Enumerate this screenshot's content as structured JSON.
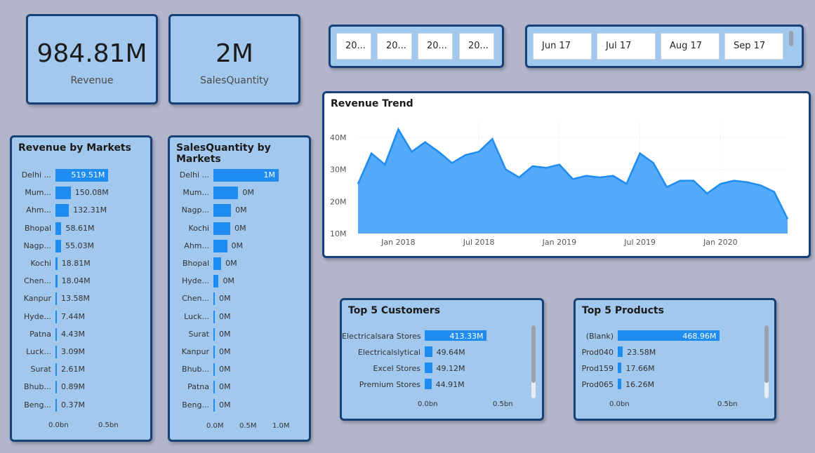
{
  "kpis": {
    "revenue_value": "984.81M",
    "revenue_label": "Revenue",
    "qty_value": "2M",
    "qty_label": "SalesQuantity"
  },
  "year_slicer": {
    "items": [
      "20...",
      "20...",
      "20...",
      "20..."
    ]
  },
  "month_slicer": {
    "items": [
      "Jun 17",
      "Jul 17",
      "Aug 17",
      "Sep 17"
    ]
  },
  "rev_by_market": {
    "title": "Revenue by Markets",
    "rows": [
      {
        "label": "Delhi ...",
        "value": 519.51,
        "text": "519.51M"
      },
      {
        "label": "Mum...",
        "value": 150.08,
        "text": "150.08M"
      },
      {
        "label": "Ahm...",
        "value": 132.31,
        "text": "132.31M"
      },
      {
        "label": "Bhopal",
        "value": 58.61,
        "text": "58.61M"
      },
      {
        "label": "Nagp...",
        "value": 55.03,
        "text": "55.03M"
      },
      {
        "label": "Kochi",
        "value": 18.81,
        "text": "18.81M"
      },
      {
        "label": "Chen...",
        "value": 18.04,
        "text": "18.04M"
      },
      {
        "label": "Kanpur",
        "value": 13.58,
        "text": "13.58M"
      },
      {
        "label": "Hyde...",
        "value": 7.44,
        "text": "7.44M"
      },
      {
        "label": "Patna",
        "value": 4.43,
        "text": "4.43M"
      },
      {
        "label": "Luck...",
        "value": 3.09,
        "text": "3.09M"
      },
      {
        "label": "Surat",
        "value": 2.61,
        "text": "2.61M"
      },
      {
        "label": "Bhub...",
        "value": 0.89,
        "text": "0.89M"
      },
      {
        "label": "Beng...",
        "value": 0.37,
        "text": "0.37M"
      }
    ],
    "axis": [
      "0.0bn",
      "0.5bn"
    ]
  },
  "qty_by_market": {
    "title": "SalesQuantity by Markets",
    "rows": [
      {
        "label": "Delhi ...",
        "value": 1.0,
        "text": "1M"
      },
      {
        "label": "Mum...",
        "value": 0.38,
        "text": "0M"
      },
      {
        "label": "Nagp...",
        "value": 0.27,
        "text": "0M"
      },
      {
        "label": "Kochi",
        "value": 0.26,
        "text": "0M"
      },
      {
        "label": "Ahm...",
        "value": 0.21,
        "text": "0M"
      },
      {
        "label": "Bhopal",
        "value": 0.12,
        "text": "0M"
      },
      {
        "label": "Hyde...",
        "value": 0.08,
        "text": "0M"
      },
      {
        "label": "Chen...",
        "value": 0.02,
        "text": "0M"
      },
      {
        "label": "Luck...",
        "value": 0.02,
        "text": "0M"
      },
      {
        "label": "Surat",
        "value": 0.01,
        "text": "0M"
      },
      {
        "label": "Kanpur",
        "value": 0.01,
        "text": "0M"
      },
      {
        "label": "Bhub...",
        "value": 0.01,
        "text": "0M"
      },
      {
        "label": "Patna",
        "value": 0.01,
        "text": "0M"
      },
      {
        "label": "Beng...",
        "value": 0.01,
        "text": "0M"
      }
    ],
    "axis": [
      "0.0M",
      "0.5M",
      "1.0M"
    ]
  },
  "chart_data": {
    "type": "area",
    "title": "Revenue Trend",
    "x": [
      "2017-10",
      "2017-11",
      "2017-12",
      "2018-01",
      "2018-02",
      "2018-03",
      "2018-04",
      "2018-05",
      "2018-06",
      "2018-07",
      "2018-08",
      "2018-09",
      "2018-10",
      "2018-11",
      "2018-12",
      "2019-01",
      "2019-02",
      "2019-03",
      "2019-04",
      "2019-05",
      "2019-06",
      "2019-07",
      "2019-08",
      "2019-09",
      "2019-10",
      "2019-11",
      "2019-12",
      "2020-01",
      "2020-02",
      "2020-03",
      "2020-04",
      "2020-05",
      "2020-06"
    ],
    "values": [
      25.5,
      35,
      31.5,
      42.5,
      35.5,
      38.5,
      35.5,
      32,
      34.5,
      35.5,
      39.5,
      30,
      27.5,
      31,
      30.5,
      31.5,
      27,
      28,
      27.5,
      28,
      25.5,
      35,
      32,
      24.5,
      26.5,
      26.5,
      22.5,
      25.5,
      26.5,
      26,
      25,
      23,
      14.5
    ],
    "x_ticks": [
      "Jan 2018",
      "Jul 2018",
      "Jan 2019",
      "Jul 2019",
      "Jan 2020"
    ],
    "y_ticks": [
      "10M",
      "20M",
      "30M",
      "40M"
    ],
    "ylim": [
      10,
      45
    ],
    "color": "#55a9fb",
    "line_color": "#1e8cf0"
  },
  "top_customers": {
    "title": "Top 5 Customers",
    "rows": [
      {
        "label": "Electricalsara Stores",
        "value": 413.33,
        "text": "413.33M"
      },
      {
        "label": "Electricalslytical",
        "value": 49.64,
        "text": "49.64M"
      },
      {
        "label": "Excel Stores",
        "value": 49.12,
        "text": "49.12M"
      },
      {
        "label": "Premium Stores",
        "value": 44.91,
        "text": "44.91M"
      }
    ],
    "axis": [
      "0.0bn",
      "0.5bn"
    ]
  },
  "top_products": {
    "title": "Top 5 Products",
    "rows": [
      {
        "label": "(Blank)",
        "value": 468.96,
        "text": "468.96M"
      },
      {
        "label": "Prod040",
        "value": 23.58,
        "text": "23.58M"
      },
      {
        "label": "Prod159",
        "value": 17.66,
        "text": "17.66M"
      },
      {
        "label": "Prod065",
        "value": 16.26,
        "text": "16.26M"
      }
    ],
    "axis": [
      "0.0bn",
      "0.5bn"
    ]
  }
}
